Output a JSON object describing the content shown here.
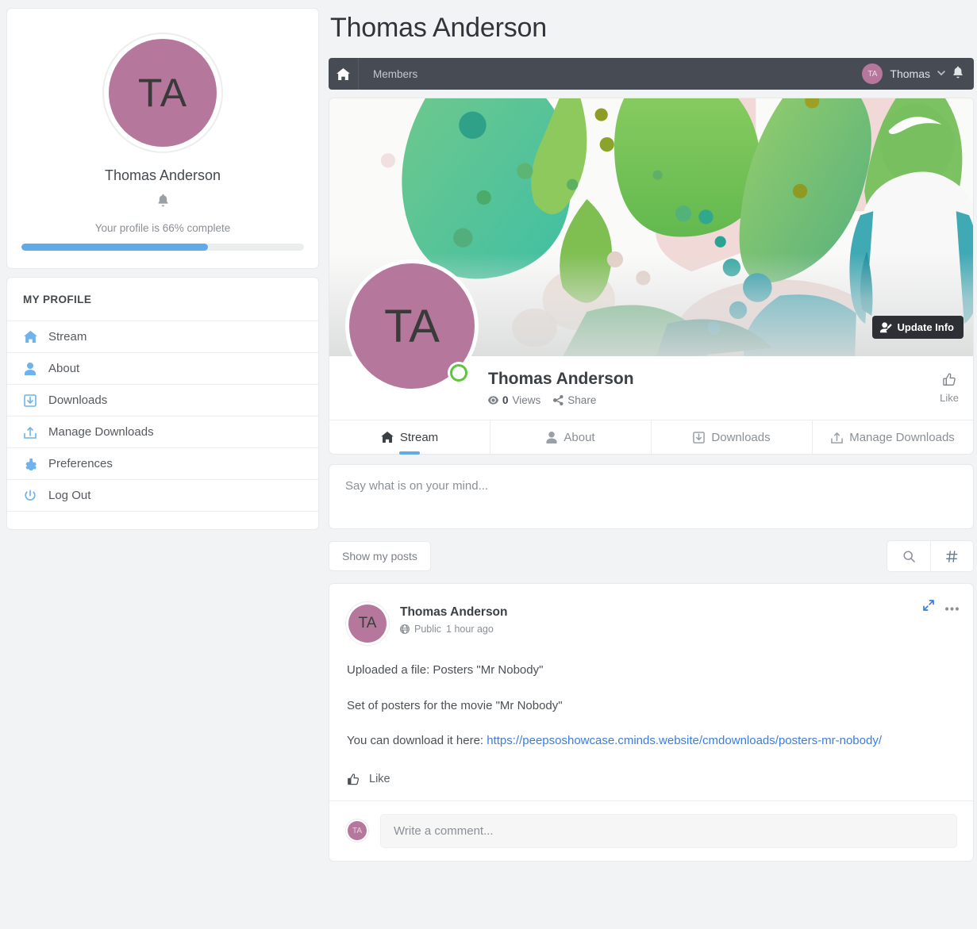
{
  "sidebar": {
    "profile": {
      "avatar_initials": "TA",
      "name": "Thomas Anderson",
      "bell_icon": "bell-icon",
      "progress_text": "Your profile is 66% complete",
      "progress_percent": 66,
      "progress_color": "#61aaea",
      "avatar_color": "#b5789c"
    },
    "menu_title": "MY PROFILE",
    "items": [
      {
        "label": "Stream",
        "icon": "home-icon"
      },
      {
        "label": "About",
        "icon": "user-icon"
      },
      {
        "label": "Downloads",
        "icon": "download-icon"
      },
      {
        "label": "Manage Downloads",
        "icon": "upload-icon"
      },
      {
        "label": "Preferences",
        "icon": "gear-icon"
      },
      {
        "label": "Log Out",
        "icon": "power-icon"
      }
    ]
  },
  "header": {
    "page_title": "Thomas Anderson"
  },
  "navbar": {
    "home_icon": "home-icon",
    "breadcrumb": "Members",
    "user_initials": "TA",
    "user_name": "Thomas",
    "caret_icon": "chevron-down-icon",
    "bell_icon": "bell-icon",
    "background": "#474c54"
  },
  "cover": {
    "update_info_label": "Update Info",
    "update_info_icon": "user-edit-icon"
  },
  "profile": {
    "avatar_initials": "TA",
    "name": "Thomas Anderson",
    "views_count": "0",
    "views_label": "Views",
    "views_icon": "eye-icon",
    "share_label": "Share",
    "share_icon": "share-icon",
    "like_label": "Like",
    "like_icon": "thumbs-up-icon",
    "status": "online"
  },
  "tabs": [
    {
      "label": "Stream",
      "icon": "home-icon",
      "active": true
    },
    {
      "label": "About",
      "icon": "user-icon",
      "active": false
    },
    {
      "label": "Downloads",
      "icon": "download-icon",
      "active": false
    },
    {
      "label": "Manage Downloads",
      "icon": "upload-icon",
      "active": false
    }
  ],
  "composer": {
    "placeholder": "Say what is on your mind..."
  },
  "filters": {
    "show_my_posts_label": "Show my posts",
    "search_icon": "search-icon",
    "hashtag_icon": "hashtag-icon"
  },
  "post": {
    "avatar_initials": "TA",
    "author": "Thomas Anderson",
    "privacy": "Public",
    "privacy_icon": "globe-icon",
    "time": "1 hour ago",
    "expand_icon": "expand-icon",
    "more_icon": "ellipsis-icon",
    "line1": "Uploaded a file: Posters \"Mr Nobody\"",
    "line2": "Set of posters for the movie \"Mr Nobody\"",
    "line3_prefix": "You can download it here: ",
    "link_text": "https://peepsoshowcase.cminds.website/cmdownloads/posters-mr-nobody/",
    "link_color": "#3b7ddd",
    "like_label": "Like",
    "like_icon": "thumbs-up-icon",
    "comment_avatar_initials": "TA",
    "comment_placeholder": "Write a comment..."
  }
}
